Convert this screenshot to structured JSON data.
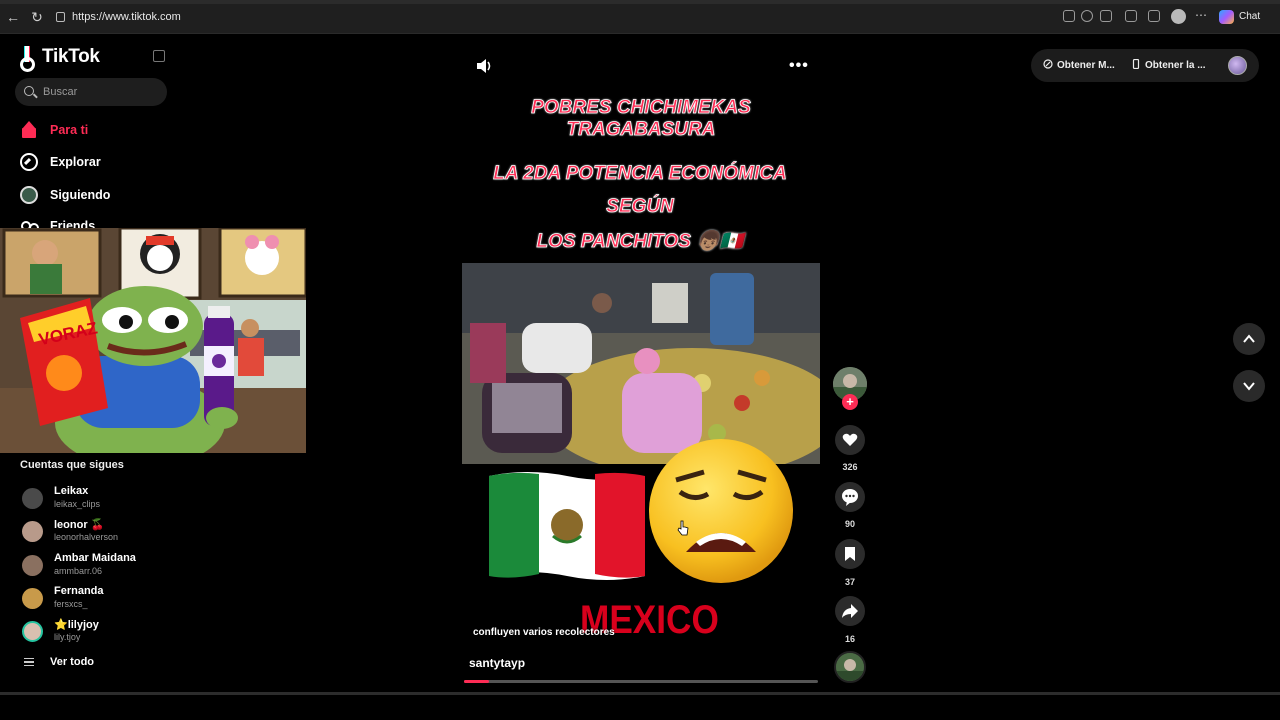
{
  "browser": {
    "url": "https://www.tiktok.com",
    "chat_label": "Chat"
  },
  "sidebar": {
    "logo": "TikTok",
    "search_placeholder": "Buscar",
    "nav": [
      {
        "label": "Para ti",
        "icon": "home-icon",
        "active": true
      },
      {
        "label": "Explorar",
        "icon": "compass-icon"
      },
      {
        "label": "Siguiendo",
        "icon": "following-icon"
      },
      {
        "label": "Friends",
        "icon": "friends-icon"
      }
    ],
    "followed_title": "Cuentas que sigues",
    "accounts": [
      {
        "name": "Leikax",
        "handle": "leikax_clips"
      },
      {
        "name": "leonor 🍒",
        "handle": "leonorhalverson"
      },
      {
        "name": "Ambar Maidana",
        "handle": "ammbarr.06"
      },
      {
        "name": "Fernanda",
        "handle": "fersxcs_"
      },
      {
        "name": "⭐lilyjoy",
        "handle": "lily.tjoy"
      }
    ],
    "see_all": "Ver todo"
  },
  "overlay": {
    "chips_label": "VORAZ"
  },
  "video": {
    "headline_1": "POBRES CHICHIMEKAS TRAGABASURA",
    "headline_2": "LA 2DA POTENCIA ECONÓMICA",
    "headline_3": "SEGÚN",
    "headline_4": "LOS PANCHITOS 👦🏽🇲🇽",
    "flag_text": "MEXICO",
    "caption": "confluyen varios recolectores",
    "author": "santytayp",
    "progress": 0.07
  },
  "actions": {
    "likes": "326",
    "comments": "90",
    "saves": "37",
    "shares": "16"
  },
  "topbar": {
    "get_coins": "Obtener M...",
    "get_app": "Obtener la ..."
  },
  "colors": {
    "accent": "#fe2c55",
    "background": "#000000"
  }
}
